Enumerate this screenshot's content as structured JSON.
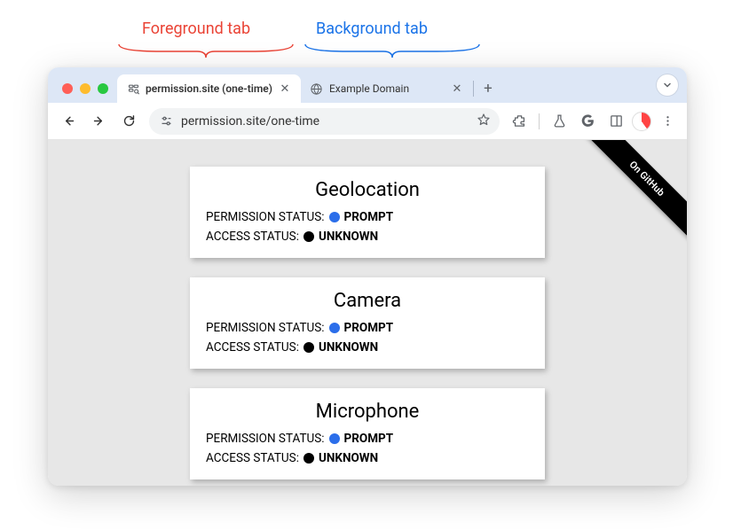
{
  "annotations": {
    "foreground_label": "Foreground tab",
    "background_label": "Background tab"
  },
  "browser": {
    "tabs": [
      {
        "title": "permission.site (one-time)",
        "active": true
      },
      {
        "title": "Example Domain",
        "active": false
      }
    ],
    "url": "permission.site/one-time",
    "github_ribbon": "On GitHub"
  },
  "cards": [
    {
      "title": "Geolocation",
      "permission_label": "PERMISSION STATUS:",
      "permission_value": "PROMPT",
      "permission_color": "blue",
      "access_label": "ACCESS STATUS:",
      "access_value": "UNKNOWN",
      "access_color": "black"
    },
    {
      "title": "Camera",
      "permission_label": "PERMISSION STATUS:",
      "permission_value": "PROMPT",
      "permission_color": "blue",
      "access_label": "ACCESS STATUS:",
      "access_value": "UNKNOWN",
      "access_color": "black"
    },
    {
      "title": "Microphone",
      "permission_label": "PERMISSION STATUS:",
      "permission_value": "PROMPT",
      "permission_color": "blue",
      "access_label": "ACCESS STATUS:",
      "access_value": "UNKNOWN",
      "access_color": "black"
    }
  ]
}
